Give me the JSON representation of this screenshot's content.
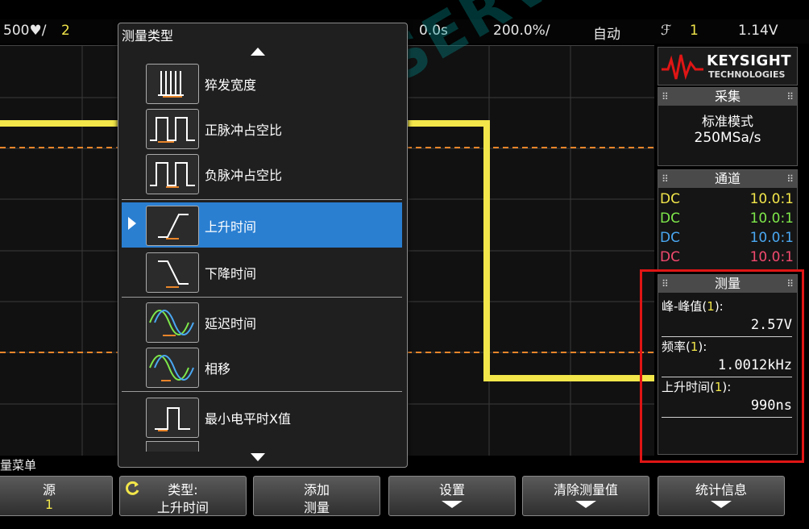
{
  "status_bar": {
    "volts_div": "500♥/",
    "channel_number": "2",
    "time_offset": "0.0s",
    "time_div": "200.0%/",
    "trigger_mode": "自动",
    "trigger_symbol": "ℱ",
    "trigger_channel": "1",
    "trigger_level": "1.14V"
  },
  "dropdown": {
    "title": "测量类型",
    "items": [
      {
        "label": "猝发宽度",
        "icon": "burst-width-icon"
      },
      {
        "label": "正脉冲占空比",
        "icon": "positive-duty-cycle-icon"
      },
      {
        "label": "负脉冲占空比",
        "icon": "negative-duty-cycle-icon"
      },
      {
        "label": "上升时间",
        "icon": "rise-time-icon",
        "selected": true
      },
      {
        "label": "下降时间",
        "icon": "fall-time-icon"
      },
      {
        "label": "延迟时间",
        "icon": "delay-icon"
      },
      {
        "label": "相移",
        "icon": "phase-icon"
      },
      {
        "label": "最小电平时X值",
        "icon": "x-at-min-icon"
      }
    ]
  },
  "brand": {
    "name": "KEYSIGHT",
    "sub": "TECHNOLOGIES"
  },
  "acquire": {
    "title": "采集",
    "mode": "标准模式",
    "rate": "250MSa/s"
  },
  "channels": {
    "title": "通道",
    "rows": [
      {
        "coupling": "DC",
        "probe": "10.0:1",
        "color": "#f2e64a"
      },
      {
        "coupling": "DC",
        "probe": "10.0:1",
        "color": "#7ee84a"
      },
      {
        "coupling": "DC",
        "probe": "10.0:1",
        "color": "#4aa8f2"
      },
      {
        "coupling": "DC",
        "probe": "10.0:1",
        "color": "#f24a6e"
      }
    ]
  },
  "measure": {
    "title": "测量",
    "items": [
      {
        "label": "峰-峰值",
        "src": "1",
        "value": "2.57V"
      },
      {
        "label": "频率",
        "src": "1",
        "value": "1.0012kHz"
      },
      {
        "label": "上升时间",
        "src": "1",
        "value": "990ns"
      }
    ]
  },
  "menu_label": "量菜单",
  "softkeys": [
    {
      "line1": "源",
      "line2": "1"
    },
    {
      "line1": "类型:",
      "line2": "上升时间"
    },
    {
      "line1": "添加",
      "line2": "测量"
    },
    {
      "line1": "设置",
      "line2": ""
    },
    {
      "line1": "清除测量值",
      "line2": ""
    },
    {
      "line1": "统计信息",
      "line2": ""
    }
  ],
  "watermark": "AGITEK SERVICE",
  "colors": {
    "trace": "#f2e64a",
    "trigger_line": "#e8852a",
    "selection": "#2a7fd1",
    "highlight_box": "#e01515"
  }
}
